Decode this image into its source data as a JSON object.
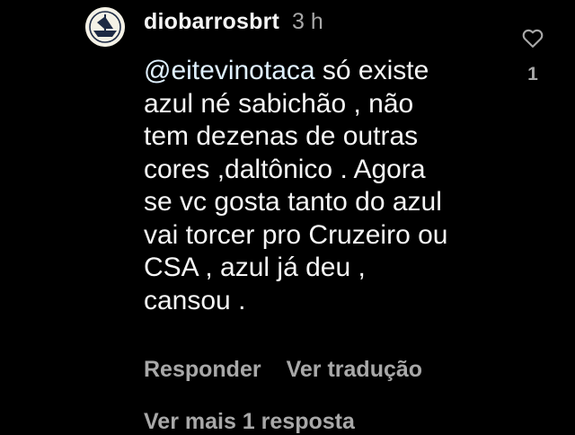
{
  "comment": {
    "avatar_icon": "boat-logo-avatar",
    "username": "diobarrosbrt",
    "timestamp": "3 h",
    "mention": "@eitevinotaca",
    "text_lines": [
      " só existe",
      "azul né sabichão , não",
      "tem dezenas de outras",
      "cores ,daltônico . Agora",
      "se vc gosta tanto do azul",
      "vai torcer pro Cruzeiro ou",
      "CSA , azul já deu ,",
      "cansou ."
    ],
    "like_icon": "heart-outline-icon",
    "like_count": "1",
    "actions": {
      "reply_label": "Responder",
      "translate_label": "Ver tradução"
    },
    "more_replies_label": "Ver mais 1 resposta"
  },
  "colors": {
    "background": "#000000",
    "primary_text": "#f5f5f5",
    "secondary_text": "#a8a8a8",
    "mention": "#e0f1ff"
  }
}
